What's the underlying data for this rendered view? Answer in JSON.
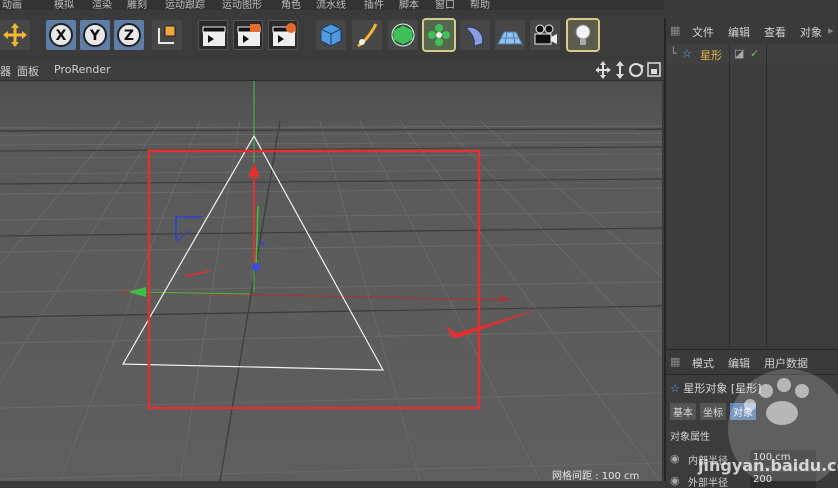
{
  "menu": [
    "动画",
    "模拟",
    "渲染",
    "雕刻",
    "运动跟踪",
    "运动图形",
    "角色",
    "流水线",
    "插件",
    "脚本",
    "窗口",
    "帮助"
  ],
  "toolbar": {
    "x_label": "X",
    "y_label": "Y",
    "z_label": "Z"
  },
  "viewport_header": {
    "menu_panel": "面板",
    "menu_prorender": "ProRender",
    "left_fragment": "器"
  },
  "grid_status": "网格间距 : 100 cm",
  "object_manager": {
    "menus": [
      "文件",
      "编辑",
      "查看",
      "对象"
    ],
    "objects": [
      {
        "name": "星形"
      }
    ]
  },
  "attributes": {
    "menus": [
      "模式",
      "编辑",
      "用户数据"
    ],
    "title": "星形对象 [星形]",
    "tabs": [
      "基本",
      "坐标",
      "对象"
    ],
    "section": "对象属性",
    "fields": [
      {
        "label": "内部半径",
        "value": "100 cm"
      },
      {
        "label": "外部半径",
        "value": "200"
      }
    ]
  },
  "watermark": "jingyan.baidu.com",
  "colors": {
    "highlight_box": "#e03030",
    "arrow": "#e03030",
    "accent_selected": "#d9c98a",
    "object_name": "#e0b44a"
  }
}
